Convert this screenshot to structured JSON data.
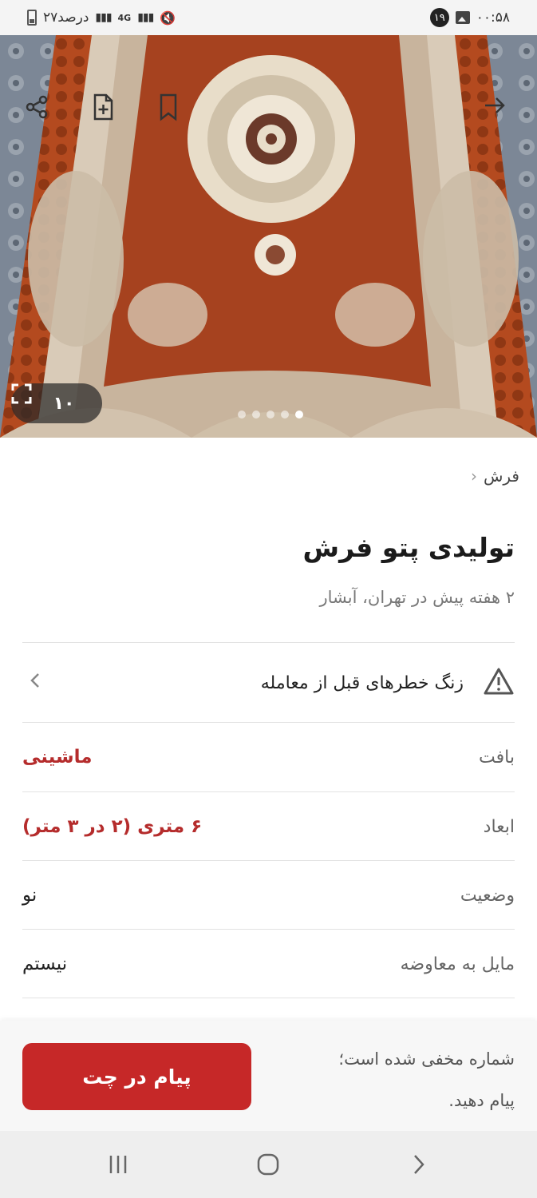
{
  "status_bar": {
    "time": "۰۰:۵۸",
    "notification_count": "۱۹",
    "battery_text": "۲۷درصد",
    "network": "4G"
  },
  "gallery": {
    "image_count": "۱۰",
    "dots_total": 5,
    "dots_active_index": 4
  },
  "breadcrumb": {
    "category": "فرش"
  },
  "listing": {
    "title": "تولیدی پتو فرش",
    "subtitle": "۲ هفته پیش در تهران، آبشار"
  },
  "warning": {
    "text": "زنگ خطرهای قبل از معامله"
  },
  "attributes": [
    {
      "label": "بافت",
      "value": "ماشینی",
      "highlight": true
    },
    {
      "label": "ابعاد",
      "value": "۶ متری (۲ در ۳ متر)",
      "highlight": true
    },
    {
      "label": "وضعیت",
      "value": "نو",
      "highlight": false
    },
    {
      "label": "مایل به معاوضه",
      "value": "نیستم",
      "highlight": false
    }
  ],
  "bottom": {
    "chat_button": "پیام در چت",
    "hidden_note_line1": "شماره مخفی شده است؛",
    "hidden_note_line2": "پیام دهید."
  },
  "colors": {
    "accent_red": "#c62828",
    "value_red": "#b52c2c",
    "rug_red": "#a6421f"
  },
  "icons": [
    "share-icon",
    "add-note-icon",
    "bookmark-icon",
    "back-arrow-icon",
    "fullscreen-icon",
    "warning-icon",
    "chevron-left-icon"
  ]
}
